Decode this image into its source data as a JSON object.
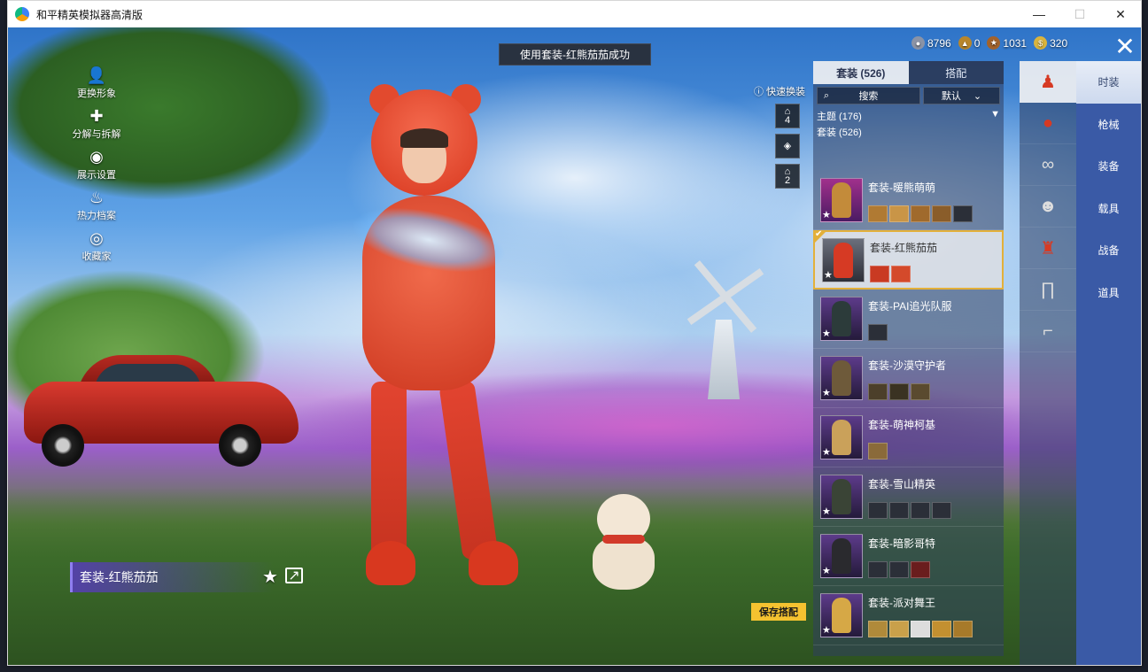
{
  "window": {
    "title": "和平精英模拟器高清版",
    "minimize": "—",
    "maximize": "☐",
    "close": "✕"
  },
  "notification": "使用套装-红熊茄茄成功",
  "currency": [
    {
      "value": "8796",
      "icon": "silver-coin-icon",
      "color": "#8a93a6"
    },
    {
      "value": "0",
      "icon": "gold-badge-icon",
      "color": "#b8862b"
    },
    {
      "value": "1031",
      "icon": "bronze-coin-icon",
      "color": "#a3622b"
    },
    {
      "value": "320",
      "icon": "gold-coin-icon",
      "color": "#d9b43d"
    }
  ],
  "left_menu": [
    {
      "label": "更换形象",
      "icon": "person-icon"
    },
    {
      "label": "分解与拆解",
      "icon": "decompose-icon"
    },
    {
      "label": "展示设置",
      "icon": "eye-icon"
    },
    {
      "label": "热力档案",
      "icon": "flame-icon"
    },
    {
      "label": "收藏家",
      "icon": "collector-badge-icon"
    }
  ],
  "quick_change": {
    "label": "快速换装",
    "slots": [
      "4",
      "",
      "2"
    ]
  },
  "tabs": [
    {
      "label": "套装 (526)",
      "active": true
    },
    {
      "label": "搭配",
      "active": false
    }
  ],
  "search": {
    "placeholder": "搜索",
    "sort": "默认"
  },
  "group": {
    "theme": "主题 (176)",
    "suits": "套装 (526)"
  },
  "outfits": [
    {
      "name": "套装-暖熊萌萌",
      "parts": 5,
      "color": "#c38b3a",
      "selected": false
    },
    {
      "name": "套装-红熊茄茄",
      "parts": 2,
      "color": "#d63a24",
      "selected": true
    },
    {
      "name": "套装-PAI追光队服",
      "parts": 1,
      "color": "#2c3b3a",
      "selected": false
    },
    {
      "name": "套装-沙漠守护者",
      "parts": 3,
      "color": "#6e5a3a",
      "selected": false
    },
    {
      "name": "套装-萌神柯基",
      "parts": 1,
      "color": "#caa15a",
      "selected": false
    },
    {
      "name": "套装-雪山精英",
      "parts": 4,
      "color": "#3a4436",
      "selected": false
    },
    {
      "name": "套装-暗影哥特",
      "parts": 3,
      "color": "#2a2a2e",
      "selected": false
    },
    {
      "name": "套装-派对舞王",
      "parts": 5,
      "color": "#d6a846",
      "selected": false
    }
  ],
  "categories": [
    {
      "icon": "full-outfit-icon",
      "active": true
    },
    {
      "icon": "head-accessory-icon",
      "active": false
    },
    {
      "icon": "goggles-icon",
      "active": false
    },
    {
      "icon": "face-mask-icon",
      "active": false
    },
    {
      "icon": "top-clothing-icon",
      "active": false
    },
    {
      "icon": "pants-icon",
      "active": false
    },
    {
      "icon": "shoes-icon",
      "active": false
    }
  ],
  "sections": [
    {
      "label": "时装",
      "active": true
    },
    {
      "label": "枪械",
      "active": false
    },
    {
      "label": "装备",
      "active": false
    },
    {
      "label": "载具",
      "active": false
    },
    {
      "label": "战备",
      "active": false
    },
    {
      "label": "道具",
      "active": false
    }
  ],
  "current_outfit": "套装-红熊茄茄",
  "save_button": "保存搭配"
}
